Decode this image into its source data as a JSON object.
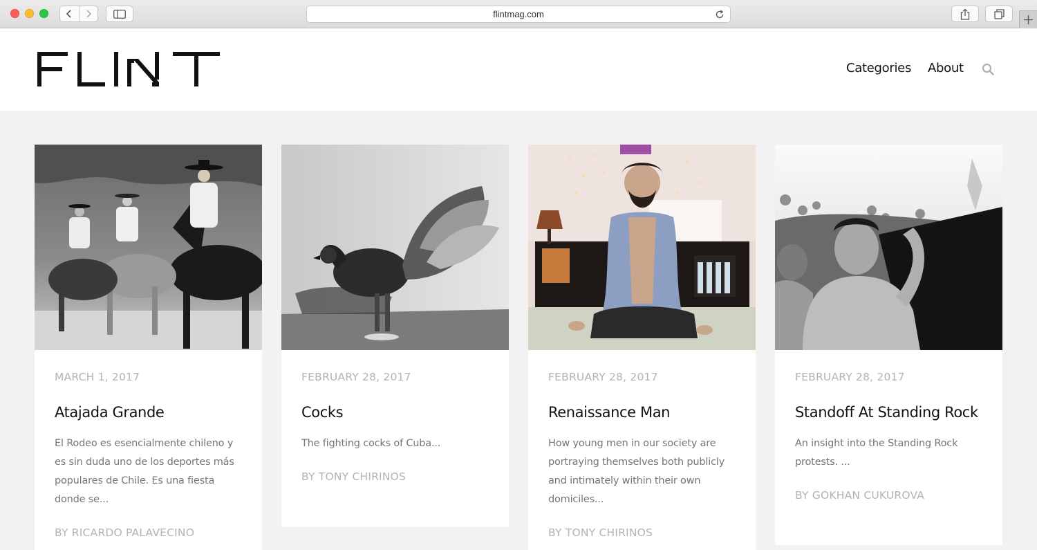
{
  "browser": {
    "url": "flintmag.com"
  },
  "site": {
    "logo": "FLINT",
    "nav": {
      "categories": "Categories",
      "about": "About"
    }
  },
  "posts": [
    {
      "date": "MARCH 1, 2017",
      "title": "Atajada Grande",
      "excerpt": "El Rodeo es esencialmente chileno y es sin duda uno de los deportes más populares de Chile. Es una fiesta donde se...",
      "author": "BY RICARDO PALAVECINO",
      "image": "rodeo-riders-photo"
    },
    {
      "date": "FEBRUARY 28, 2017",
      "title": "Cocks",
      "excerpt": "The fighting cocks of Cuba...",
      "author": "BY TONY CHIRINOS",
      "image": "rooster-photo"
    },
    {
      "date": "FEBRUARY 28, 2017",
      "title": "Renaissance Man",
      "excerpt": "How young men in our society are portraying themselves both publicly and intimately within their own domiciles...",
      "author": "BY TONY CHIRINOS",
      "image": "meditating-man-photo"
    },
    {
      "date": "FEBRUARY 28, 2017",
      "title": "Standoff At Standing Rock",
      "excerpt": "An insight into the Standing Rock protests. ...",
      "author": "BY GOKHAN CUKUROVA",
      "image": "protesters-photo"
    }
  ]
}
